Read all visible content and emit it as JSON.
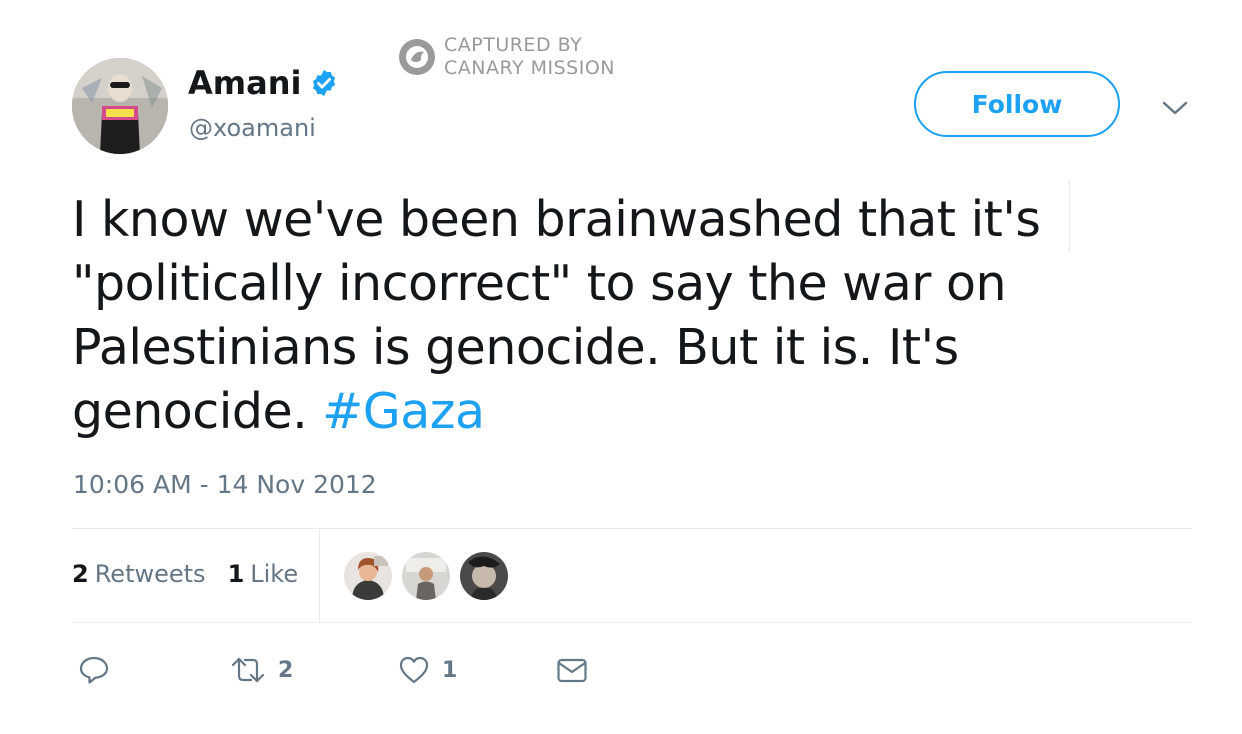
{
  "user": {
    "display_name": "Amani",
    "handle": "@xoamani",
    "verified": true,
    "avatar_icon": "user-avatar-photo"
  },
  "watermark": {
    "line1": "CAPTURED BY",
    "line2": "CANARY MISSION"
  },
  "header": {
    "follow_label": "Follow",
    "menu_icon": "chevron-down-icon"
  },
  "tweet": {
    "text_main": "I know we've been brainwashed that it's \"politically incorrect\" to say the war on Palestinians is genocide. But it is. It's genocide. ",
    "hashtag": "#Gaza",
    "timestamp": "10:06 AM - 14 Nov 2012"
  },
  "stats": {
    "retweets_count": "2",
    "retweets_label": "Retweets",
    "likes_count": "1",
    "likes_label": "Like"
  },
  "actions": {
    "reply_icon": "reply-icon",
    "retweet_icon": "retweet-icon",
    "retweet_count": "2",
    "like_icon": "heart-icon",
    "like_count": "1",
    "dm_icon": "envelope-icon"
  },
  "colors": {
    "accent": "#1da1f2",
    "text": "#14171a",
    "secondary": "#657786",
    "divider": "#e6ecf0"
  }
}
